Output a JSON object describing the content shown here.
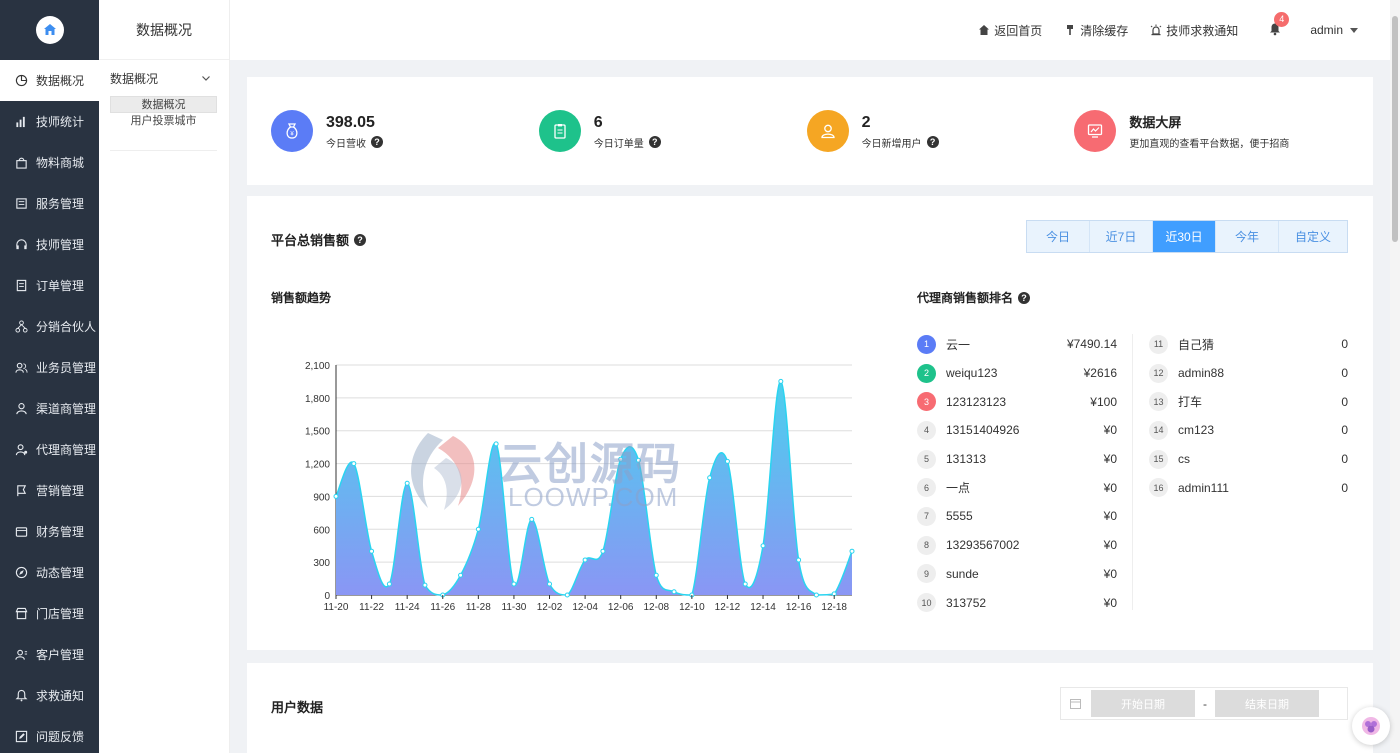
{
  "sidebar": {
    "items": [
      {
        "label": "数据概况",
        "icon": "pie-chart-icon"
      },
      {
        "label": "技师统计",
        "icon": "bar-chart-icon"
      },
      {
        "label": "物料商城",
        "icon": "shopping-bag-icon"
      },
      {
        "label": "服务管理",
        "icon": "service-icon"
      },
      {
        "label": "技师管理",
        "icon": "headset-icon"
      },
      {
        "label": "订单管理",
        "icon": "order-icon"
      },
      {
        "label": "分销合伙人",
        "icon": "network-icon"
      },
      {
        "label": "业务员管理",
        "icon": "users-icon"
      },
      {
        "label": "渠道商管理",
        "icon": "user-icon"
      },
      {
        "label": "代理商管理",
        "icon": "agent-icon"
      },
      {
        "label": "营销管理",
        "icon": "marketing-icon"
      },
      {
        "label": "财务管理",
        "icon": "wallet-icon"
      },
      {
        "label": "动态管理",
        "icon": "compass-icon"
      },
      {
        "label": "门店管理",
        "icon": "store-icon"
      },
      {
        "label": "客户管理",
        "icon": "customer-icon"
      },
      {
        "label": "求救通知",
        "icon": "bell-icon"
      },
      {
        "label": "问题反馈",
        "icon": "edit-icon"
      }
    ]
  },
  "subsidebar": {
    "title": "数据概况",
    "group": "数据概况",
    "items": [
      "数据概况",
      "用户投票城市"
    ]
  },
  "header": {
    "home": "返回首页",
    "clear_cache": "清除缓存",
    "sos": "技师求救通知",
    "badge": "4",
    "user": "admin"
  },
  "stats": [
    {
      "value": "398.05",
      "label": "今日营收",
      "color": "#5b7cf6",
      "icon": "money-bag-icon"
    },
    {
      "value": "6",
      "label": "今日订单量",
      "color": "#1ec28b",
      "icon": "clipboard-icon"
    },
    {
      "value": "2",
      "label": "今日新增用户",
      "color": "#f5a623",
      "icon": "user-icon"
    },
    {
      "value": "数据大屏",
      "label": "更加直观的查看平台数据，便于招商",
      "color": "#f76b72",
      "icon": "monitor-icon"
    }
  ],
  "sales": {
    "title": "平台总销售额",
    "tabs": [
      "今日",
      "近7日",
      "近30日",
      "今年",
      "自定义"
    ],
    "active_tab": 2,
    "trend_title": "销售额趋势",
    "rank_title": "代理商销售额排名"
  },
  "chart_data": {
    "type": "area",
    "x": [
      "11-20",
      "11-21",
      "11-22",
      "11-23",
      "11-24",
      "11-25",
      "11-26",
      "11-27",
      "11-28",
      "11-29",
      "11-30",
      "12-01",
      "12-02",
      "12-03",
      "12-04",
      "12-05",
      "12-06",
      "12-07",
      "12-08",
      "12-09",
      "12-10",
      "12-11",
      "12-12",
      "12-13",
      "12-14",
      "12-15",
      "12-16",
      "12-17",
      "12-18",
      "12-19"
    ],
    "x_tick_labels": [
      "11-20",
      "11-22",
      "11-24",
      "11-26",
      "11-28",
      "11-30",
      "12-02",
      "12-04",
      "12-06",
      "12-08",
      "12-10",
      "12-12",
      "12-14",
      "12-16",
      "12-18"
    ],
    "values": [
      900,
      1200,
      400,
      100,
      1020,
      90,
      0,
      180,
      600,
      1380,
      100,
      690,
      100,
      0,
      320,
      400,
      1240,
      1230,
      180,
      30,
      0,
      1070,
      1220,
      100,
      450,
      1950,
      320,
      0,
      10,
      400
    ],
    "ylim": [
      0,
      2100
    ],
    "yticks": [
      "0",
      "300",
      "600",
      "900",
      "1,200",
      "1,500",
      "1,800",
      "2,100"
    ],
    "grid": true,
    "colors": {
      "line": "#2ad4f0",
      "fill_top": "#4ad0ee",
      "fill_bottom": "#8a96f4"
    }
  },
  "ranking_left": [
    {
      "rank": "1",
      "name": "云一",
      "value": "¥7490.14",
      "color": "#5b7cf6"
    },
    {
      "rank": "2",
      "name": "weiqu123",
      "value": "¥2616",
      "color": "#1ec28b"
    },
    {
      "rank": "3",
      "name": "123123123",
      "value": "¥100",
      "color": "#f76b72"
    },
    {
      "rank": "4",
      "name": "13151404926",
      "value": "¥0",
      "color": ""
    },
    {
      "rank": "5",
      "name": "131313",
      "value": "¥0",
      "color": ""
    },
    {
      "rank": "6",
      "name": "一点",
      "value": "¥0",
      "color": ""
    },
    {
      "rank": "7",
      "name": "5555",
      "value": "¥0",
      "color": ""
    },
    {
      "rank": "8",
      "name": "13293567002",
      "value": "¥0",
      "color": ""
    },
    {
      "rank": "9",
      "name": "sunde",
      "value": "¥0",
      "color": ""
    },
    {
      "rank": "10",
      "name": "313752",
      "value": "¥0",
      "color": ""
    }
  ],
  "ranking_right": [
    {
      "rank": "11",
      "name": "自己猜",
      "value": "0"
    },
    {
      "rank": "12",
      "name": "admin88",
      "value": "0"
    },
    {
      "rank": "13",
      "name": "打车",
      "value": "0"
    },
    {
      "rank": "14",
      "name": "cm123",
      "value": "0"
    },
    {
      "rank": "15",
      "name": "cs",
      "value": "0"
    },
    {
      "rank": "16",
      "name": "admin111",
      "value": "0"
    }
  ],
  "user_data": {
    "title": "用户数据",
    "start_placeholder": "开始日期",
    "end_placeholder": "结束日期",
    "separator": "-"
  },
  "watermark": {
    "text": "云创源码",
    "subtext": "LOOWP.COM"
  }
}
